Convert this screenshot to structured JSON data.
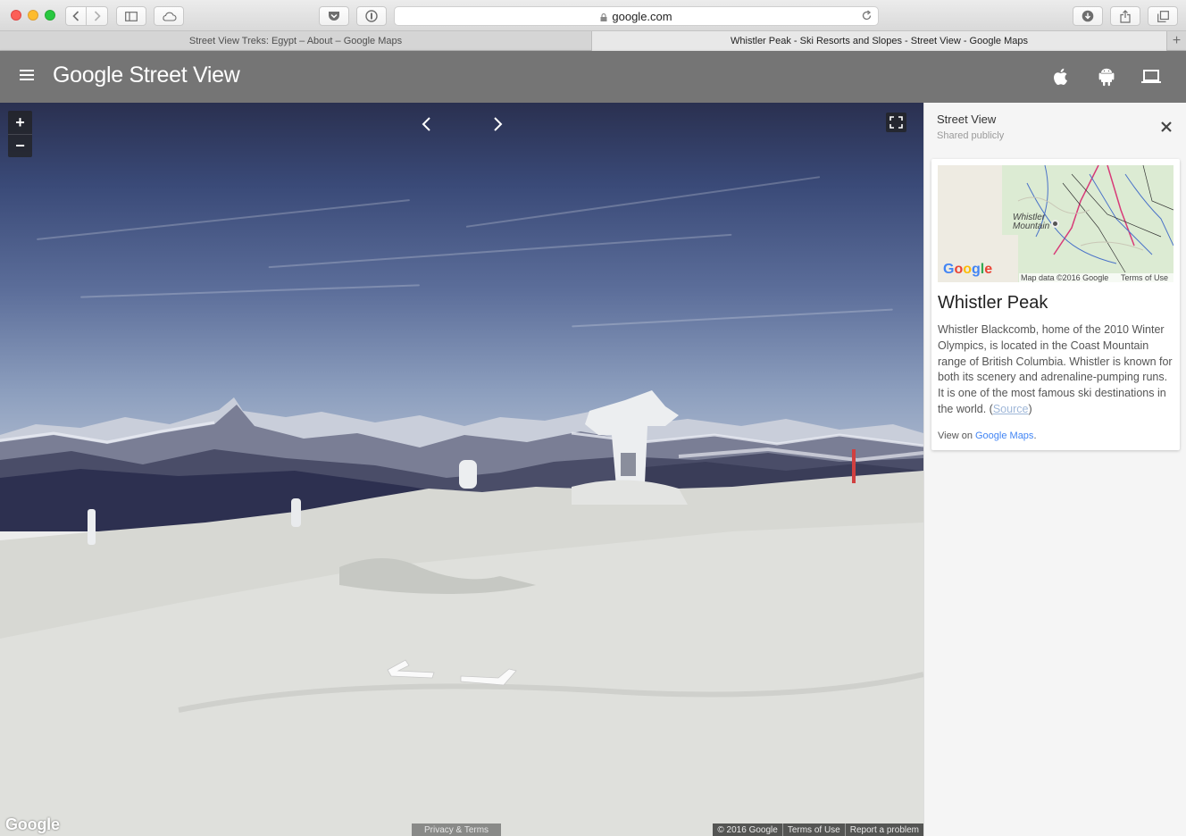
{
  "browser": {
    "url": "google.com",
    "tabs": [
      {
        "label": "Street View Treks: Egypt – About – Google Maps",
        "active": false
      },
      {
        "label": "Whistler Peak - Ski Resorts and Slopes - Street View - Google Maps",
        "active": true
      }
    ],
    "new_tab_label": "+"
  },
  "header": {
    "brand": "Google Street View",
    "icons": [
      "apple-icon",
      "android-icon",
      "laptop-icon"
    ]
  },
  "viewer": {
    "zoom_in": "+",
    "zoom_out": "−",
    "google_logo": "Google",
    "privacy_terms": "Privacy & Terms",
    "attribution": [
      "© 2016 Google",
      "Terms of Use",
      "Report a problem"
    ]
  },
  "panel": {
    "title": "Street View",
    "subtitle": "Shared publicly",
    "card": {
      "map_label": "Whistler Mountain",
      "map_google": "Google",
      "map_data": "Map data ©2016 Google",
      "map_terms": "Terms of Use",
      "place_name": "Whistler Peak",
      "description": "Whistler Blackcomb, home of the 2010 Winter Olympics, is located in the Coast Mountain range of British Columbia. Whistler is known for both its scenery and adrenaline-pumping runs. It is one of the most famous ski destinations in the world. (",
      "source_link": "Source",
      "description_end": ")",
      "view_on_prefix": "View on ",
      "view_on_link": "Google Maps",
      "view_on_suffix": "."
    }
  },
  "colors": {
    "appbar": "#757575",
    "link": "#4285f4"
  }
}
